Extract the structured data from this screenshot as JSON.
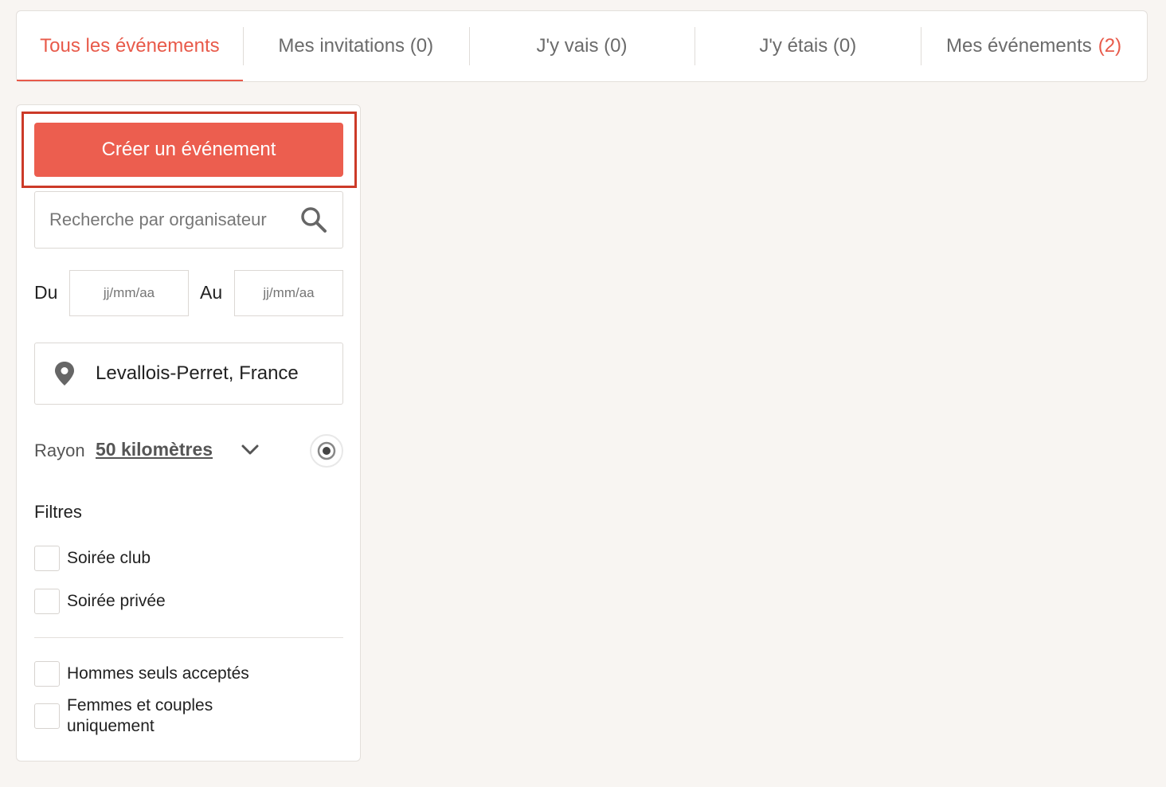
{
  "tabs": [
    {
      "label": "Tous les événements",
      "count": "",
      "active": true
    },
    {
      "label": "Mes invitations (0)",
      "count": "",
      "active": false
    },
    {
      "label": "J'y vais (0)",
      "count": "",
      "active": false
    },
    {
      "label": "J'y étais (0)",
      "count": "",
      "active": false
    },
    {
      "label": "Mes événements",
      "count": "(2)",
      "active": false
    }
  ],
  "sidebar": {
    "create_button": "Créer un événement",
    "search_placeholder": "Recherche par organisateur",
    "date_from_label": "Du",
    "date_from_placeholder": "jj/mm/aa",
    "date_to_label": "Au",
    "date_to_placeholder": "jj/mm/aa",
    "location": "Levallois-Perret, France",
    "radius_label": "Rayon",
    "radius_value": "50 kilomètres",
    "filters_title": "Filtres",
    "filters": [
      {
        "label": "Soirée club",
        "checked": false
      },
      {
        "label": "Soirée privée",
        "checked": false
      },
      {
        "label": "Hommes seuls acceptés",
        "checked": false
      },
      {
        "label": "Femmes et couples uniquement",
        "checked": false
      }
    ]
  },
  "colors": {
    "accent": "#ec5e4f",
    "highlight_border": "#cc3a28",
    "background": "#f8f5f2"
  },
  "icons": {
    "search": "search-icon",
    "location": "location-pin-icon",
    "chevron": "chevron-down-icon",
    "geolocate": "geolocate-target-icon"
  }
}
